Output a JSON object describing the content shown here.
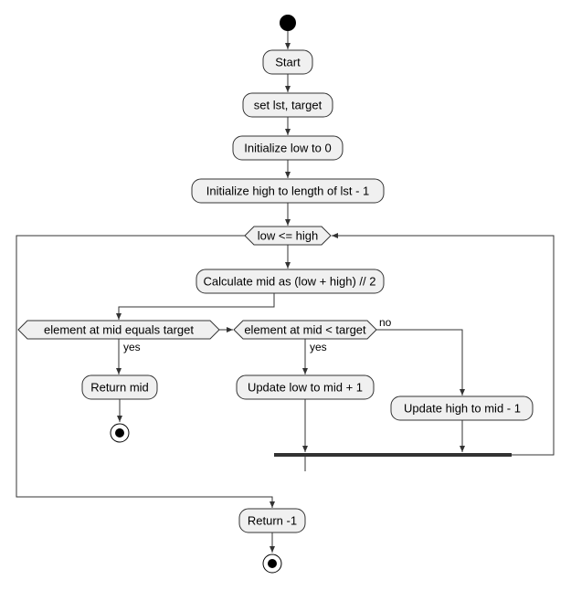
{
  "chart_data": {
    "type": "flowchart",
    "title": "",
    "nodes": [
      {
        "id": "initial",
        "kind": "initial"
      },
      {
        "id": "start",
        "kind": "action",
        "label": "Start"
      },
      {
        "id": "set",
        "kind": "action",
        "label": "set lst, target"
      },
      {
        "id": "init_low",
        "kind": "action",
        "label": "Initialize low to 0"
      },
      {
        "id": "init_high",
        "kind": "action",
        "label": "Initialize high to length of lst - 1"
      },
      {
        "id": "cond_loop",
        "kind": "decision",
        "label": "low <= high"
      },
      {
        "id": "calc_mid",
        "kind": "action",
        "label": "Calculate mid as (low + high) // 2"
      },
      {
        "id": "cond_eq",
        "kind": "decision",
        "label": "element at mid equals target"
      },
      {
        "id": "cond_lt",
        "kind": "decision",
        "label": "element at mid < target"
      },
      {
        "id": "ret_mid",
        "kind": "action",
        "label": "Return mid"
      },
      {
        "id": "upd_low",
        "kind": "action",
        "label": "Update low to mid + 1"
      },
      {
        "id": "upd_high",
        "kind": "action",
        "label": "Update high to mid - 1"
      },
      {
        "id": "merge_bar",
        "kind": "merge"
      },
      {
        "id": "ret_neg1",
        "kind": "action",
        "label": "Return -1"
      },
      {
        "id": "end1",
        "kind": "final"
      },
      {
        "id": "end2",
        "kind": "final"
      }
    ],
    "edges": [
      {
        "from": "initial",
        "to": "start"
      },
      {
        "from": "start",
        "to": "set"
      },
      {
        "from": "set",
        "to": "init_low"
      },
      {
        "from": "init_low",
        "to": "init_high"
      },
      {
        "from": "init_high",
        "to": "cond_loop"
      },
      {
        "from": "cond_loop",
        "to": "calc_mid",
        "label": ""
      },
      {
        "from": "calc_mid",
        "to": "cond_eq"
      },
      {
        "from": "cond_eq",
        "to": "ret_mid",
        "label": "yes"
      },
      {
        "from": "cond_eq",
        "to": "cond_lt",
        "label": ""
      },
      {
        "from": "cond_lt",
        "to": "upd_low",
        "label": "yes"
      },
      {
        "from": "cond_lt",
        "to": "upd_high",
        "label": "no"
      },
      {
        "from": "ret_mid",
        "to": "end1"
      },
      {
        "from": "upd_low",
        "to": "merge_bar"
      },
      {
        "from": "upd_high",
        "to": "merge_bar"
      },
      {
        "from": "merge_bar",
        "to": "cond_loop",
        "kind": "loop_back"
      },
      {
        "from": "cond_loop",
        "to": "ret_neg1",
        "kind": "loop_exit"
      },
      {
        "from": "ret_neg1",
        "to": "end2"
      }
    ]
  },
  "labels": {
    "start": "Start",
    "set": "set lst, target",
    "init_low": "Initialize low to 0",
    "init_high": "Initialize high to length of lst - 1",
    "cond_loop": "low <= high",
    "calc_mid": "Calculate mid as (low + high) // 2",
    "cond_eq": "element at mid equals target",
    "cond_lt": "element at mid < target",
    "ret_mid": "Return mid",
    "upd_low": "Update low to mid + 1",
    "upd_high": "Update high to mid - 1",
    "ret_neg1": "Return -1",
    "yes": "yes",
    "no": "no"
  }
}
